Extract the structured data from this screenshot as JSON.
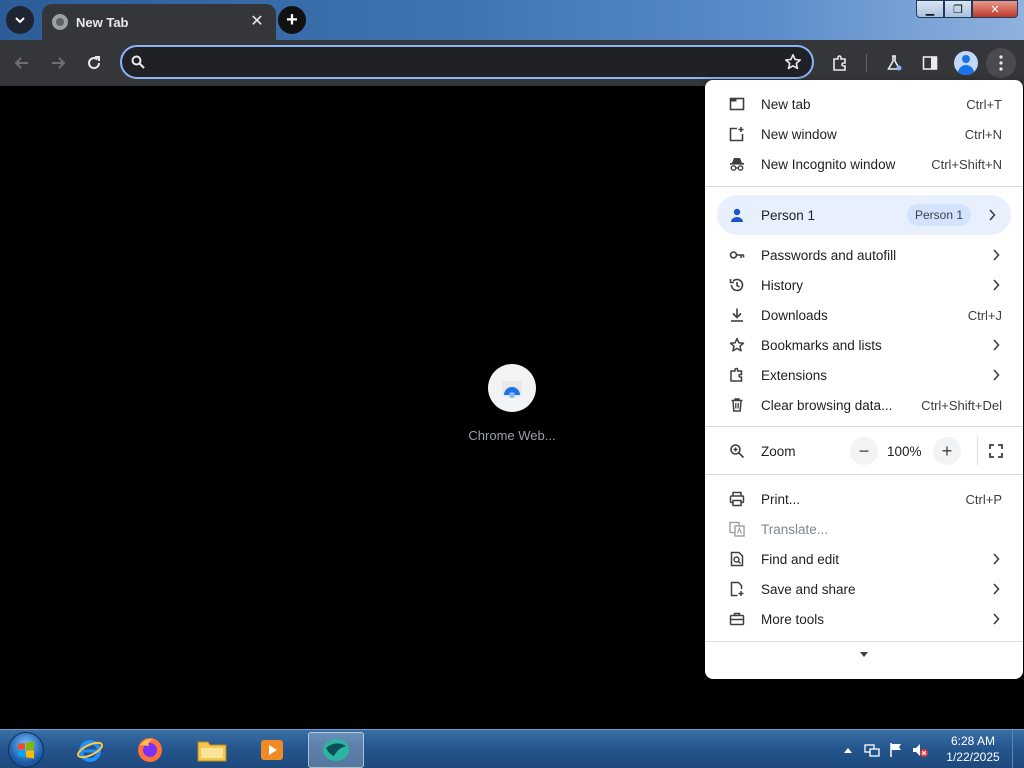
{
  "browser": {
    "tab_title": "New Tab",
    "omnibox": {
      "value": "",
      "placeholder": ""
    }
  },
  "page": {
    "shortcut_label": "Chrome Web..."
  },
  "menu": {
    "items_top": [
      {
        "label": "New tab",
        "shortcut": "Ctrl+T",
        "icon": "new-tab-icon"
      },
      {
        "label": "New window",
        "shortcut": "Ctrl+N",
        "icon": "new-window-icon"
      },
      {
        "label": "New Incognito window",
        "shortcut": "Ctrl+Shift+N",
        "icon": "incognito-icon"
      }
    ],
    "profile": {
      "name": "Person 1",
      "chip": "Person 1"
    },
    "items_mid": [
      {
        "label": "Passwords and autofill",
        "shortcut": "",
        "icon": "key-icon",
        "submenu": true
      },
      {
        "label": "History",
        "shortcut": "",
        "icon": "history-icon",
        "submenu": true
      },
      {
        "label": "Downloads",
        "shortcut": "Ctrl+J",
        "icon": "download-icon",
        "submenu": false
      },
      {
        "label": "Bookmarks and lists",
        "shortcut": "",
        "icon": "star-icon",
        "submenu": true
      },
      {
        "label": "Extensions",
        "shortcut": "",
        "icon": "puzzle-icon",
        "submenu": true
      },
      {
        "label": "Clear browsing data...",
        "shortcut": "Ctrl+Shift+Del",
        "icon": "trash-icon",
        "submenu": false
      }
    ],
    "zoom": {
      "label": "Zoom",
      "value": "100%",
      "minus": "−",
      "plus": "+"
    },
    "items_bottom": [
      {
        "label": "Print...",
        "shortcut": "Ctrl+P",
        "icon": "print-icon",
        "submenu": false,
        "disabled": false
      },
      {
        "label": "Translate...",
        "shortcut": "",
        "icon": "translate-icon",
        "submenu": false,
        "disabled": true
      },
      {
        "label": "Find and edit",
        "shortcut": "",
        "icon": "find-icon",
        "submenu": true,
        "disabled": false
      },
      {
        "label": "Save and share",
        "shortcut": "",
        "icon": "save-share-icon",
        "submenu": true,
        "disabled": false
      },
      {
        "label": "More tools",
        "shortcut": "",
        "icon": "toolbox-icon",
        "submenu": true,
        "disabled": false
      }
    ]
  },
  "taskbar": {
    "time": "6:28 AM",
    "date": "1/22/2025"
  },
  "colors": {
    "accent": "#8ab4f8",
    "profile_highlight": "#e8f0fe",
    "toolbar": "#35363a"
  }
}
